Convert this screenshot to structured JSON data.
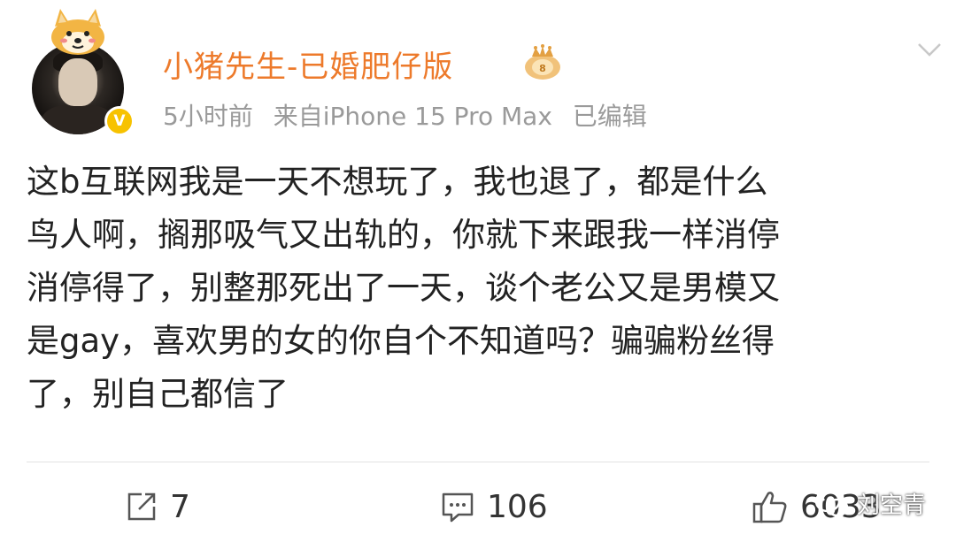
{
  "post": {
    "author": {
      "name": "小猪先生-已婚肥仔版",
      "verified_badge": "V",
      "avatar_icon": "avatar",
      "pendant_icon": "shiba-dog-pendant-icon",
      "medal_icon": "crown-medal-icon"
    },
    "meta": {
      "time": "5小时前",
      "source": "来自iPhone 15 Pro Max",
      "edited": "已编辑"
    },
    "text_lines": [
      "这b互联网我是一天不想玩了，我也退了，都是什么",
      "鸟人啊，搁那吸气又出轨的，你就下来跟我一样消停",
      "消停得了，别整那死出了一天，谈个老公又是男模又",
      "是gay，喜欢男的女的你自个不知道吗？骗骗粉丝得",
      "了，别自己都信了"
    ],
    "actions": {
      "repost_count": "7",
      "comment_count": "106",
      "like_count": "6033"
    }
  },
  "watermark": {
    "text": "刘空青",
    "icon": "wechat-icon"
  },
  "colors": {
    "username": "#ed7a2b",
    "meta": "#9a9a9a",
    "text": "#222222",
    "badge": "#f7c200"
  }
}
